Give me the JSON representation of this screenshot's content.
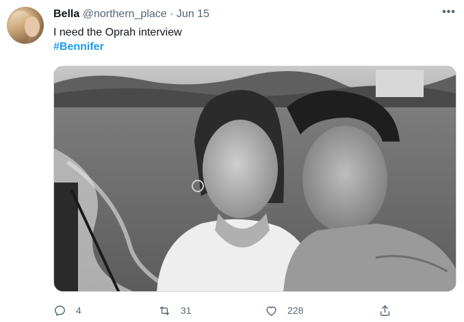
{
  "tweet": {
    "author_name": "Bella",
    "author_handle": "@northern_place",
    "separator": "·",
    "date": "Jun 15",
    "more_label": "•••",
    "text": "I need the Oprah interview",
    "hashtag": "#Bennifer",
    "media_alt": "Black and white photo of a couple on a boat"
  },
  "actions": {
    "reply_count": "4",
    "retweet_count": "31",
    "like_count": "228"
  },
  "icons": {
    "reply": "reply-icon",
    "retweet": "retweet-icon",
    "like": "heart-icon",
    "share": "share-icon",
    "more": "more-icon"
  },
  "colors": {
    "hashtag": "#1d9bf0",
    "muted": "#536471"
  }
}
